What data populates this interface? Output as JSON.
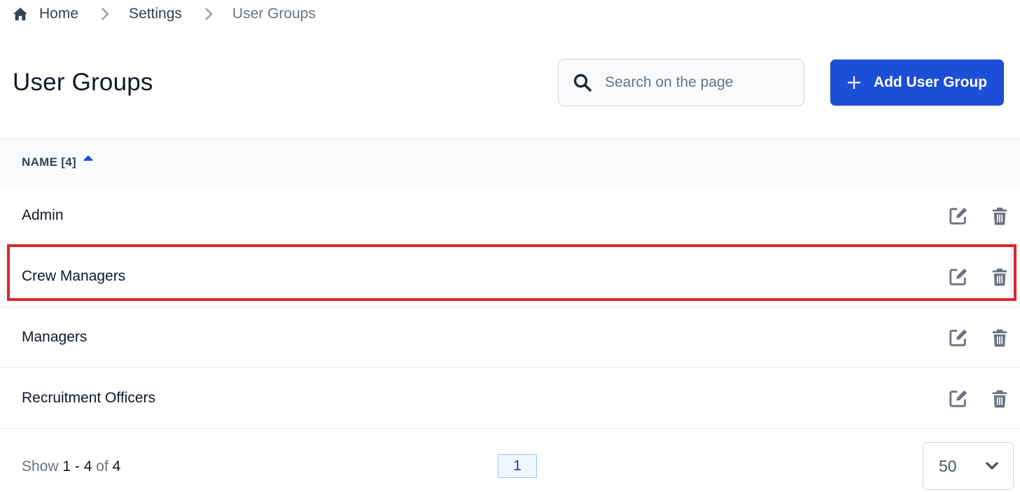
{
  "breadcrumb": {
    "items": [
      {
        "label": "Home",
        "icon": "home-icon"
      },
      {
        "label": "Settings"
      },
      {
        "label": "User Groups"
      }
    ]
  },
  "page": {
    "title": "User Groups"
  },
  "search": {
    "placeholder": "Search on the page",
    "value": ""
  },
  "toolbar": {
    "add_label": "Add User Group"
  },
  "table": {
    "columns": [
      {
        "label": "NAME [4]",
        "sort": "ascending"
      }
    ],
    "rows": [
      {
        "name": "Admin"
      },
      {
        "name": "Crew Managers",
        "highlighted": true
      },
      {
        "name": "Managers"
      },
      {
        "name": "Recruitment Officers"
      }
    ]
  },
  "pagination": {
    "show_label": "Show",
    "range_start": "1",
    "range_sep": "-",
    "range_end": "4",
    "of_label": "of",
    "total": "4",
    "current_page": "1",
    "page_size": "50"
  },
  "colors": {
    "accent": "#1d4ed8",
    "highlight": "#dc2626",
    "header_bg": "#f9fafb",
    "icon_gray": "#6b7280"
  }
}
